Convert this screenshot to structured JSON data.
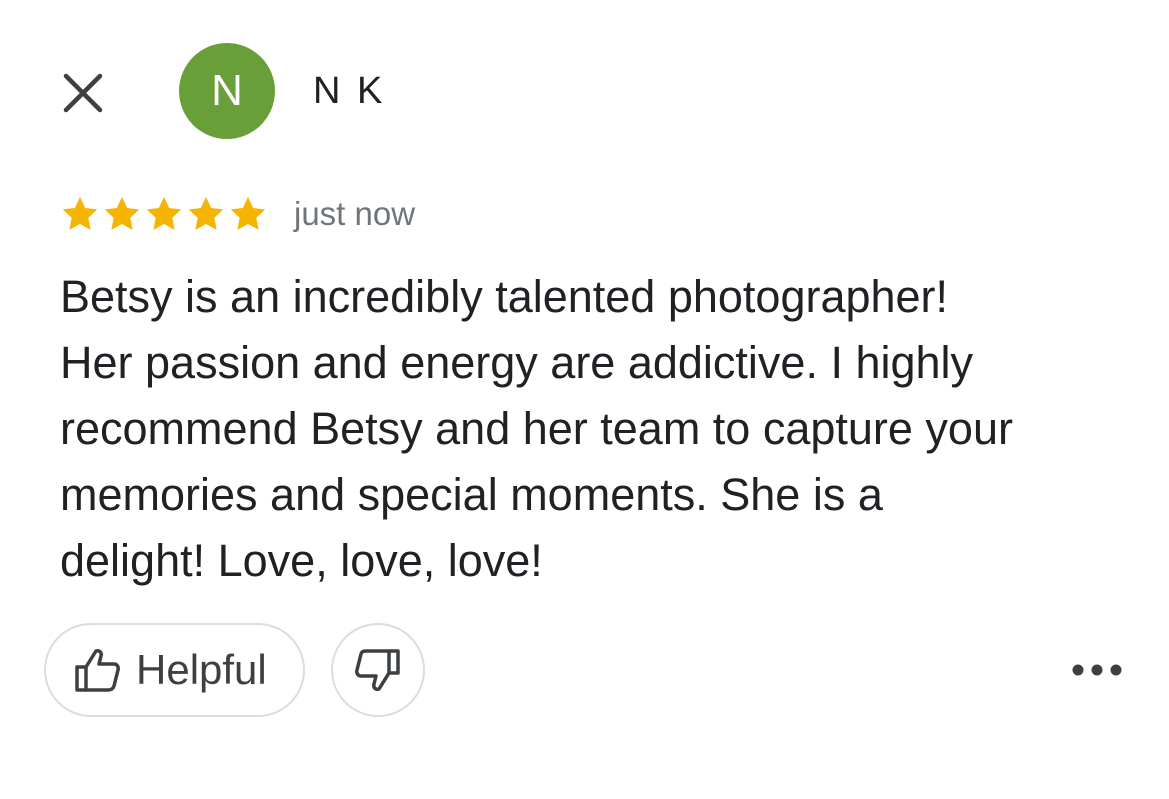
{
  "header": {
    "close_icon": "close-icon",
    "avatar_initial": "N",
    "avatar_color": "#689f38",
    "reviewer_name": "N K"
  },
  "review": {
    "rating": 5,
    "max_rating": 5,
    "star_color": "#f4b400",
    "timestamp": "just now",
    "text": "Betsy is an incredibly talented photographer!\nHer passion and energy are addictive. I highly\nrecommend Betsy and her team to capture your\nmemories and special moments. She is a\ndelight! Love, love, love!"
  },
  "actions": {
    "helpful_label": "Helpful",
    "helpful_icon": "thumbs-up-icon",
    "dislike_icon": "thumbs-down-icon",
    "more_icon": "more-horizontal-icon"
  }
}
